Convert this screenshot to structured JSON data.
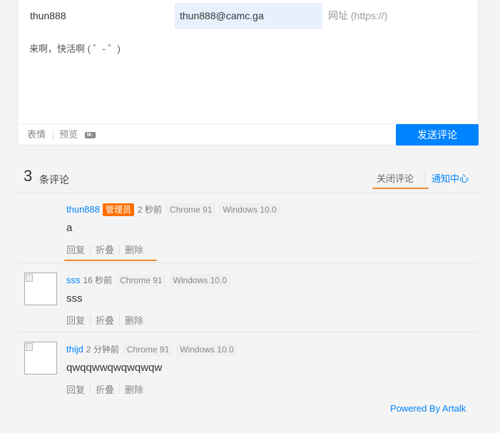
{
  "editor": {
    "nick_value": "thun888",
    "email_value": "thun888@camc.ga",
    "link_placeholder": "网址 (https://)",
    "text_value": "来啊，快活啊 ( ゜- ゜)",
    "emoji_label": "表情",
    "preview_label": "预览",
    "markdown_icon_text": "M↓",
    "send_label": "发送评论"
  },
  "list": {
    "count": "3",
    "count_suffix": "条评论",
    "close_comment_label": "关闭评论",
    "notify_center_label": "通知中心"
  },
  "comments": [
    {
      "nick": "thun888",
      "badge": "管理员",
      "time": "2 秒前",
      "browser": "Chrome 91",
      "os": "Windows 10.0",
      "content": "a",
      "actions": [
        "回复",
        "折叠",
        "删除"
      ]
    },
    {
      "nick": "sss",
      "time": "16 秒前",
      "browser": "Chrome 91",
      "os": "Windows 10.0",
      "content": "sss",
      "actions": [
        "回复",
        "折叠",
        "删除"
      ]
    },
    {
      "nick": "thijd",
      "time": "2 分钟前",
      "browser": "Chrome 91",
      "os": "Windows 10.0",
      "content": "qwqqwwqwqwqwqw",
      "actions": [
        "回复",
        "折叠",
        "删除"
      ]
    }
  ],
  "footer": {
    "powered_by": "Powered By Artalk"
  },
  "colors": {
    "accent": "#0083ff",
    "badge": "#ff6f00",
    "highlight_line": "#f28a2f"
  }
}
